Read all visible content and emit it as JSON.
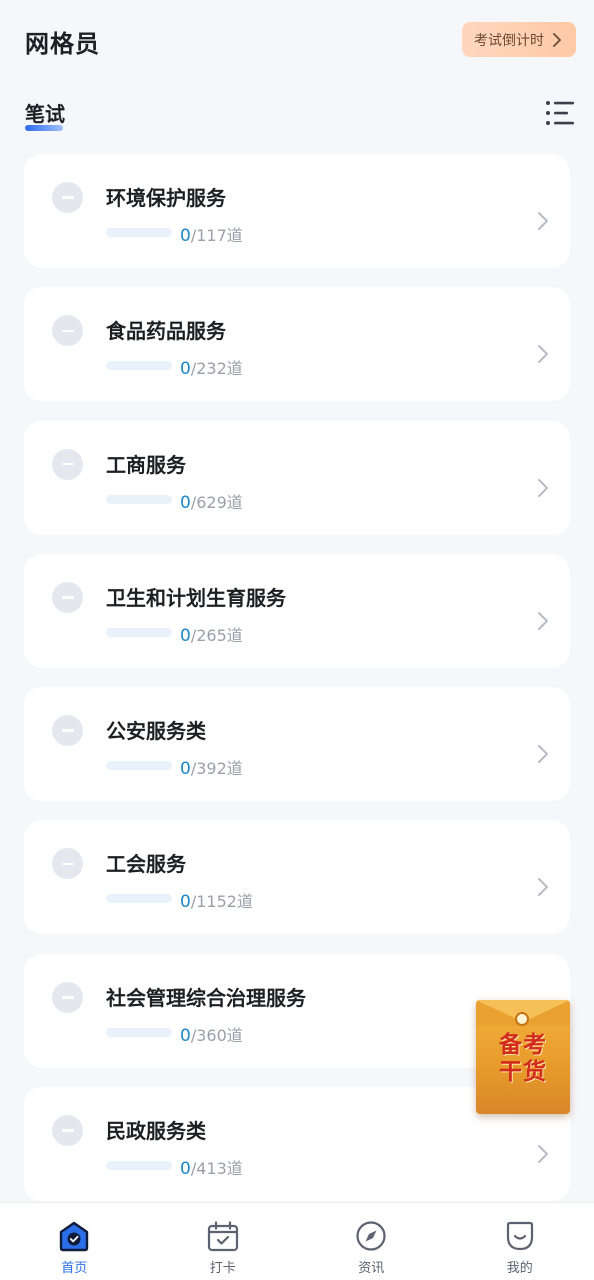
{
  "header": {
    "title": "网格员",
    "countdown_label": "考试倒计时"
  },
  "section": {
    "title": "笔试"
  },
  "courses": [
    {
      "title": "环境保护服务",
      "done": "0",
      "total": "/117道",
      "progress": 0
    },
    {
      "title": "食品药品服务",
      "done": "0",
      "total": "/232道",
      "progress": 0
    },
    {
      "title": "工商服务",
      "done": "0",
      "total": "/629道",
      "progress": 0
    },
    {
      "title": "卫生和计划生育服务",
      "done": "0",
      "total": "/265道",
      "progress": 0
    },
    {
      "title": "公安服务类",
      "done": "0",
      "total": "/392道",
      "progress": 0
    },
    {
      "title": "工会服务",
      "done": "0",
      "total": "/1152道",
      "progress": 0
    },
    {
      "title": "社会管理综合治理服务",
      "done": "0",
      "total": "/360道",
      "progress": 0
    },
    {
      "title": "民政服务类",
      "done": "0",
      "total": "/413道",
      "progress": 0
    }
  ],
  "floating_badge": {
    "line1": "备考",
    "line2": "干货"
  },
  "bottom_nav": {
    "items": [
      {
        "label": "首页",
        "icon": "home-icon",
        "active": true
      },
      {
        "label": "打卡",
        "icon": "calendar-check-icon",
        "active": false
      },
      {
        "label": "资讯",
        "icon": "compass-icon",
        "active": false
      },
      {
        "label": "我的",
        "icon": "profile-icon",
        "active": false
      }
    ]
  },
  "colors": {
    "accent": "#2b6fe8",
    "progress_done": "#1f86c9",
    "countdown_bg": "#ffc9a6",
    "badge_text": "#d22a1d"
  }
}
